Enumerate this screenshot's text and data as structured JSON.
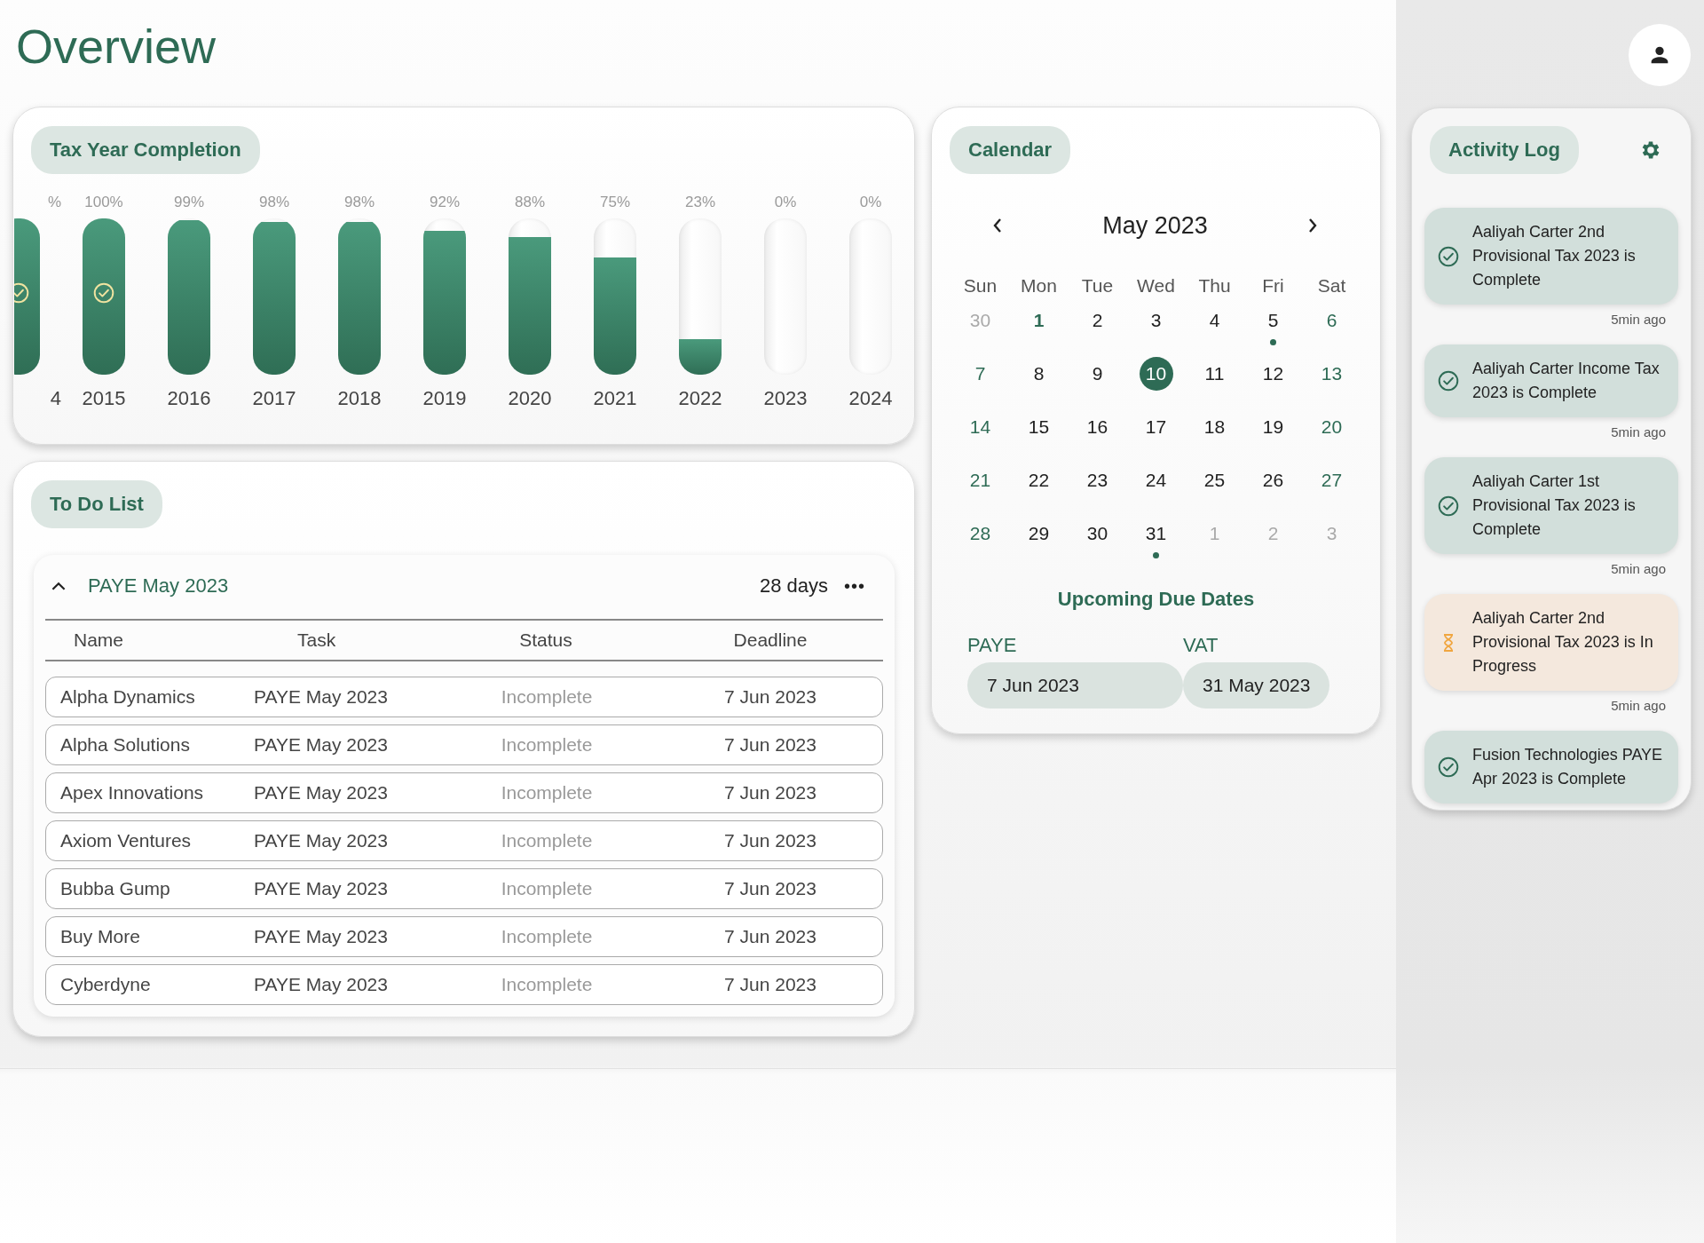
{
  "page_title": "Overview",
  "tax_years": {
    "title": "Tax Year Completion",
    "bars": [
      {
        "year": "4",
        "reading": "%",
        "level": 1,
        "complete": true
      },
      {
        "year": "2015",
        "reading": "100%",
        "level": 1,
        "complete": true
      },
      {
        "year": "2016",
        "reading": "99%",
        "level": 0.99,
        "complete": false
      },
      {
        "year": "2017",
        "reading": "98%",
        "level": 0.98,
        "complete": false
      },
      {
        "year": "2018",
        "reading": "98%",
        "level": 0.98,
        "complete": false
      },
      {
        "year": "2019",
        "reading": "92%",
        "level": 0.92,
        "complete": false
      },
      {
        "year": "2020",
        "reading": "88%",
        "level": 0.88,
        "complete": false
      },
      {
        "year": "2021",
        "reading": "75%",
        "level": 0.75,
        "complete": false
      },
      {
        "year": "2022",
        "reading": "23%",
        "level": 0.23,
        "complete": false
      },
      {
        "year": "2023",
        "reading": "0%",
        "level": 0,
        "complete": false
      },
      {
        "year": "2024",
        "reading": "0%",
        "level": 0,
        "complete": false
      }
    ]
  },
  "todo": {
    "title": "To Do List",
    "group": {
      "title": "PAYE May 2023",
      "expanded": true,
      "days": "28 days",
      "more": "•••",
      "columns": [
        "Name",
        "Task",
        "Status",
        "Deadline"
      ],
      "rows": [
        {
          "name": "Alpha Dynamics",
          "task": "PAYE May 2023",
          "status": "Incomplete",
          "deadline": "7 Jun 2023"
        },
        {
          "name": "Alpha Solutions",
          "task": "PAYE May 2023",
          "status": "Incomplete",
          "deadline": "7 Jun 2023"
        },
        {
          "name": "Apex Innovations",
          "task": "PAYE May 2023",
          "status": "Incomplete",
          "deadline": "7 Jun 2023"
        },
        {
          "name": "Axiom Ventures",
          "task": "PAYE May 2023",
          "status": "Incomplete",
          "deadline": "7 Jun 2023"
        },
        {
          "name": "Bubba Gump",
          "task": "PAYE May 2023",
          "status": "Incomplete",
          "deadline": "7 Jun 2023"
        },
        {
          "name": "Buy More",
          "task": "PAYE May 2023",
          "status": "Incomplete",
          "deadline": "7 Jun 2023"
        },
        {
          "name": "Cyberdyne",
          "task": "PAYE May 2023",
          "status": "Incomplete",
          "deadline": "7 Jun 2023"
        }
      ]
    }
  },
  "calendar": {
    "title": "Calendar",
    "month": "May 2023",
    "weekdays": [
      "Sun",
      "Mon",
      "Tue",
      "Wed",
      "Thu",
      "Fri",
      "Sat"
    ],
    "weeks": [
      [
        {
          "day": "30",
          "kind": "outside",
          "selected": false,
          "event": false
        },
        {
          "day": "1",
          "kind": "holiday",
          "selected": false,
          "event": false
        },
        {
          "day": "2",
          "kind": "weekday",
          "selected": false,
          "event": false
        },
        {
          "day": "3",
          "kind": "weekday",
          "selected": false,
          "event": false
        },
        {
          "day": "4",
          "kind": "weekday",
          "selected": false,
          "event": false
        },
        {
          "day": "5",
          "kind": "weekday",
          "selected": false,
          "event": true
        },
        {
          "day": "6",
          "kind": "weekend",
          "selected": false,
          "event": false
        }
      ],
      [
        {
          "day": "7",
          "kind": "weekend",
          "selected": false,
          "event": false
        },
        {
          "day": "8",
          "kind": "weekday",
          "selected": false,
          "event": false
        },
        {
          "day": "9",
          "kind": "weekday",
          "selected": false,
          "event": false
        },
        {
          "day": "10",
          "kind": "weekday",
          "selected": true,
          "event": false
        },
        {
          "day": "11",
          "kind": "weekday",
          "selected": false,
          "event": false
        },
        {
          "day": "12",
          "kind": "weekday",
          "selected": false,
          "event": false
        },
        {
          "day": "13",
          "kind": "weekend",
          "selected": false,
          "event": false
        }
      ],
      [
        {
          "day": "14",
          "kind": "weekend",
          "selected": false,
          "event": false
        },
        {
          "day": "15",
          "kind": "weekday",
          "selected": false,
          "event": false
        },
        {
          "day": "16",
          "kind": "weekday",
          "selected": false,
          "event": false
        },
        {
          "day": "17",
          "kind": "weekday",
          "selected": false,
          "event": false
        },
        {
          "day": "18",
          "kind": "weekday",
          "selected": false,
          "event": false
        },
        {
          "day": "19",
          "kind": "weekday",
          "selected": false,
          "event": false
        },
        {
          "day": "20",
          "kind": "weekend",
          "selected": false,
          "event": false
        }
      ],
      [
        {
          "day": "21",
          "kind": "weekend",
          "selected": false,
          "event": false
        },
        {
          "day": "22",
          "kind": "weekday",
          "selected": false,
          "event": false
        },
        {
          "day": "23",
          "kind": "weekday",
          "selected": false,
          "event": false
        },
        {
          "day": "24",
          "kind": "weekday",
          "selected": false,
          "event": false
        },
        {
          "day": "25",
          "kind": "weekday",
          "selected": false,
          "event": false
        },
        {
          "day": "26",
          "kind": "weekday",
          "selected": false,
          "event": false
        },
        {
          "day": "27",
          "kind": "weekend",
          "selected": false,
          "event": false
        }
      ],
      [
        {
          "day": "28",
          "kind": "weekend",
          "selected": false,
          "event": false
        },
        {
          "day": "29",
          "kind": "weekday",
          "selected": false,
          "event": false
        },
        {
          "day": "30",
          "kind": "weekday",
          "selected": false,
          "event": false
        },
        {
          "day": "31",
          "kind": "weekday",
          "selected": false,
          "event": true
        },
        {
          "day": "1",
          "kind": "outside",
          "selected": false,
          "event": false
        },
        {
          "day": "2",
          "kind": "outside",
          "selected": false,
          "event": false
        },
        {
          "day": "3",
          "kind": "outside",
          "selected": false,
          "event": false
        }
      ]
    ],
    "upcoming_title": "Upcoming Due Dates",
    "due_dates": [
      {
        "label": "PAYE",
        "date": "7 Jun 2023"
      },
      {
        "label": "VAT",
        "date": "31 May 2023"
      }
    ]
  },
  "activity_log": {
    "title": "Activity Log",
    "items": [
      {
        "kind": "complete",
        "text": "Aaliyah Carter 2nd Provisional Tax 2023 is Complete",
        "time": "5min ago"
      },
      {
        "kind": "complete",
        "text": "Aaliyah Carter Income Tax 2023 is Complete",
        "time": "5min ago"
      },
      {
        "kind": "complete",
        "text": "Aaliyah Carter 1st Provisional Tax 2023 is Complete",
        "time": "5min ago"
      },
      {
        "kind": "pending",
        "text": "Aaliyah Carter 2nd Provisional Tax 2023 is In Progress",
        "time": "5min ago"
      },
      {
        "kind": "complete",
        "text": "Fusion Technologies PAYE Apr 2023 is Complete"
      }
    ]
  }
}
